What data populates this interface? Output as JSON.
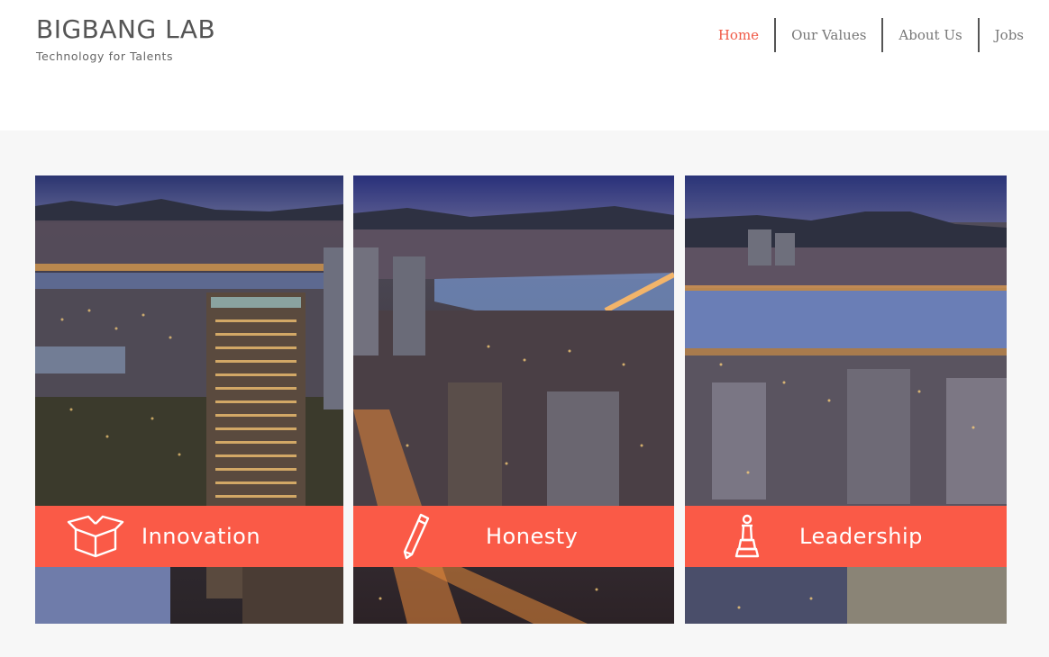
{
  "brand": {
    "title": "BIGBANG LAB",
    "tagline": "Technology for Talents"
  },
  "nav": {
    "items": [
      {
        "label": "Home",
        "active": true
      },
      {
        "label": "Our Values",
        "active": false
      },
      {
        "label": "About Us",
        "active": false
      },
      {
        "label": "Jobs",
        "active": false
      }
    ]
  },
  "values": [
    {
      "label": "Innovation",
      "icon": "open-box-icon"
    },
    {
      "label": "Honesty",
      "icon": "pencil-icon"
    },
    {
      "label": "Leadership",
      "icon": "chess-king-icon"
    }
  ],
  "colors": {
    "accent": "#fa5a47",
    "nav_active": "#f05a47",
    "band_background": "#f7f7f7"
  }
}
